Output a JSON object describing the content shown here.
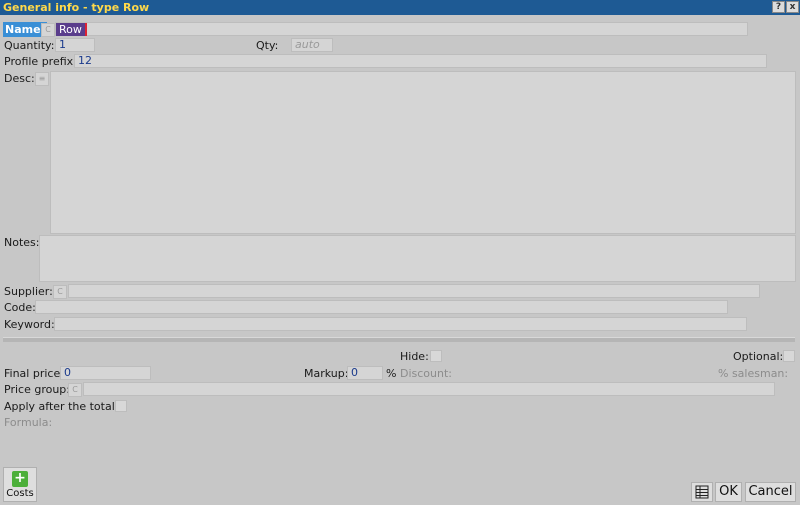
{
  "window": {
    "title": "General info - type Row",
    "help_btn": "?",
    "close_btn": "x"
  },
  "name": {
    "label": "Name:",
    "mode": "C",
    "value": "Row"
  },
  "quantity": {
    "label": "Quantity:",
    "value": "1"
  },
  "qty": {
    "label": "Qty:",
    "placeholder": "auto"
  },
  "profile_prefix": {
    "label": "Profile prefix:",
    "value": "12"
  },
  "desc": {
    "label": "Desc:"
  },
  "notes": {
    "label": "Notes:"
  },
  "supplier": {
    "label": "Supplier:",
    "mode": "C"
  },
  "code": {
    "label": "Code:"
  },
  "keyword": {
    "label": "Keyword:"
  },
  "hide": {
    "label": "Hide:"
  },
  "optional": {
    "label": "Optional:"
  },
  "final_price": {
    "label": "Final price:",
    "value": "0"
  },
  "markup": {
    "label": "Markup:",
    "value": "0",
    "unit": "%"
  },
  "discount": {
    "label": "Discount:"
  },
  "salesman": {
    "label": "% salesman:"
  },
  "price_group": {
    "label": "Price group:",
    "mode": "C"
  },
  "apply_after_total": {
    "label": "Apply after the total:"
  },
  "formula": {
    "label": "Formula:"
  },
  "footer": {
    "costs_label": "Costs",
    "ok_label": "OK",
    "cancel_label": "Cancel"
  }
}
